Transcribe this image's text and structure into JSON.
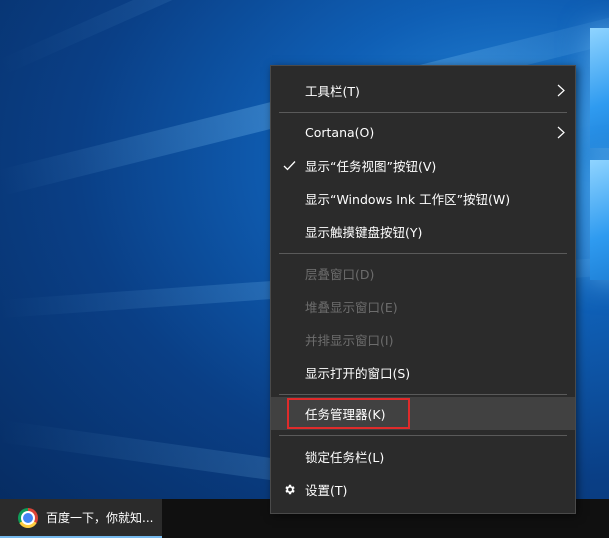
{
  "taskbar": {
    "app_label": "百度一下，你就知..."
  },
  "menu": {
    "items": [
      {
        "label": "工具栏(T)",
        "has_submenu": true
      },
      {
        "label": "Cortana(O)",
        "has_submenu": true
      },
      {
        "label": "显示“任务视图”按钮(V)",
        "checked": true
      },
      {
        "label": "显示“Windows Ink 工作区”按钮(W)"
      },
      {
        "label": "显示触摸键盘按钮(Y)"
      },
      {
        "label": "层叠窗口(D)",
        "disabled": true
      },
      {
        "label": "堆叠显示窗口(E)",
        "disabled": true
      },
      {
        "label": "并排显示窗口(I)",
        "disabled": true
      },
      {
        "label": "显示打开的窗口(S)"
      },
      {
        "label": "任务管理器(K)",
        "highlighted": true
      },
      {
        "label": "锁定任务栏(L)"
      },
      {
        "label": "设置(T)",
        "icon": "gear-icon"
      }
    ]
  },
  "colors": {
    "menu_bg": "#2b2b2b",
    "highlight_border": "#e02b2b",
    "disabled_text": "#6d6d6d"
  }
}
